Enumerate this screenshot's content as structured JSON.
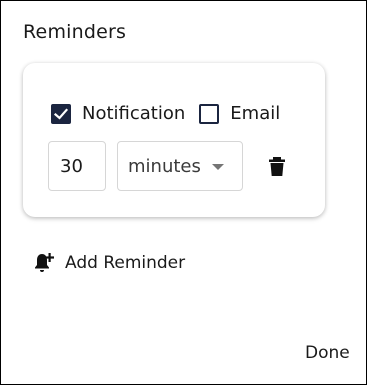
{
  "dialog": {
    "title": "Reminders"
  },
  "reminder": {
    "notification": {
      "label": "Notification",
      "checked": true
    },
    "email": {
      "label": "Email",
      "checked": false
    },
    "amount": "30",
    "unit": "minutes",
    "delete_icon": "trash-icon"
  },
  "actions": {
    "add_reminder_label": "Add Reminder",
    "add_reminder_icon": "bell-plus-icon",
    "done_label": "Done"
  },
  "colors": {
    "checkbox": "#1b2540",
    "text": "#1a1a1a",
    "border": "#d6d6d6"
  }
}
